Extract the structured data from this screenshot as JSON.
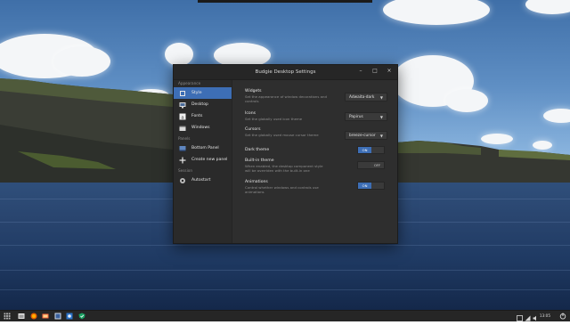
{
  "window": {
    "title": "Budgie Desktop Settings",
    "buttons": {
      "minimize": "–",
      "maximize": "□",
      "close": "×"
    }
  },
  "sidebar": {
    "sections": {
      "appearance": "Appearance",
      "panels": "Panels",
      "session": "Session"
    },
    "items": {
      "style": "Style",
      "desktop": "Desktop",
      "fonts": "Fonts",
      "windows": "Windows",
      "bottom_panel": "Bottom Panel",
      "create_panel": "Create new panel",
      "autostart": "Autostart"
    },
    "active": "style"
  },
  "settings": {
    "widgets": {
      "title": "Widgets",
      "desc": "Set the appearance of window decorations and controls",
      "value": "Adwaita-dark"
    },
    "icons": {
      "title": "Icons",
      "desc": "Set the globally used icon theme",
      "value": "Papirus"
    },
    "cursors": {
      "title": "Cursors",
      "desc": "Set the globally used mouse cursor theme",
      "value": "breeze-cursor"
    },
    "dark_theme": {
      "title": "Dark theme",
      "state": "ON"
    },
    "builtin_theme": {
      "title": "Built-in theme",
      "desc": "When enabled, the desktop component style will be overriden with the built-in one",
      "state": "OFF"
    },
    "animations": {
      "title": "Animations",
      "desc": "Control whether windows and controls use animations",
      "state": "ON"
    }
  },
  "panel": {
    "clock": "13:05"
  },
  "colors": {
    "accent": "#3d6eb5",
    "window_bg": "#2d2d2d",
    "panel_bg": "#262626"
  }
}
